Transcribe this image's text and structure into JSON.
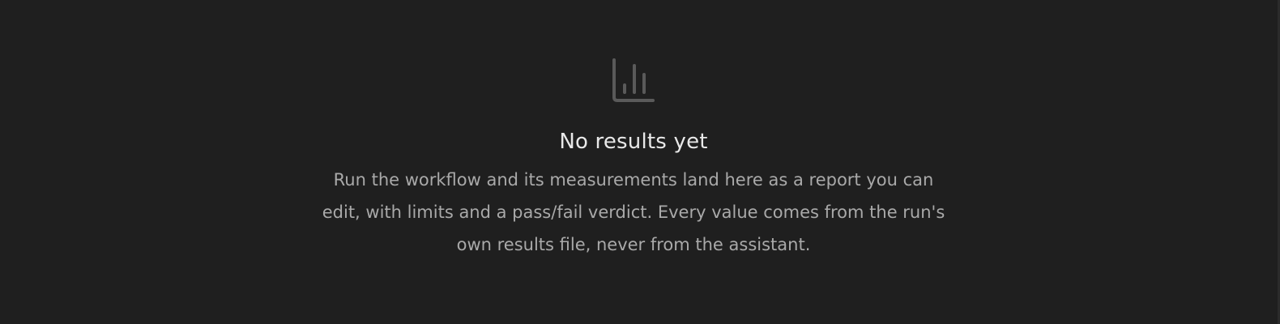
{
  "empty_state": {
    "icon": "bar-chart-icon",
    "title": "No results yet",
    "description": "Run the workflow and its measurements land here as a report you can edit, with limits and a pass/fail verdict. Every value comes from the run's own results file, never from the assistant."
  },
  "colors": {
    "background": "#1f1f1f",
    "icon": "#5a5a5a",
    "title": "#e8e8e8",
    "description": "#a9a9a9"
  }
}
